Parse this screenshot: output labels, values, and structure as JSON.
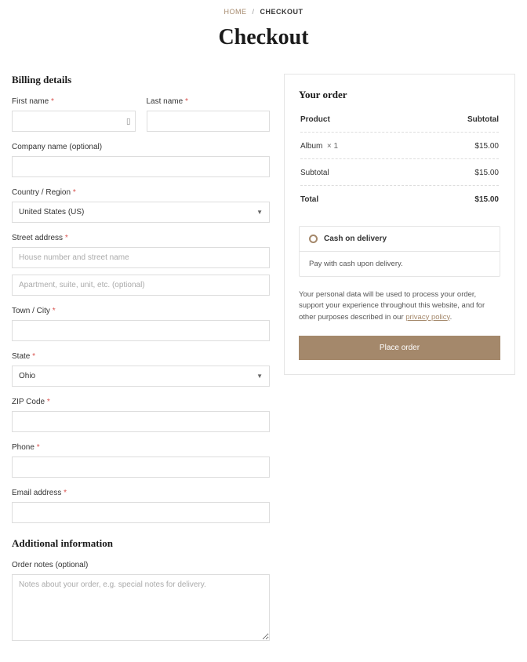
{
  "breadcrumb": {
    "home": "HOME",
    "current": "CHECKOUT"
  },
  "page_title": "Checkout",
  "billing": {
    "heading": "Billing details",
    "first_name": {
      "label": "First name",
      "value": ""
    },
    "last_name": {
      "label": "Last name",
      "value": ""
    },
    "company": {
      "label": "Company name (optional)",
      "value": ""
    },
    "country": {
      "label": "Country / Region",
      "value": "United States (US)"
    },
    "street": {
      "label": "Street address",
      "placeholder1": "House number and street name",
      "placeholder2": "Apartment, suite, unit, etc. (optional)"
    },
    "city": {
      "label": "Town / City",
      "value": ""
    },
    "state": {
      "label": "State",
      "value": "Ohio"
    },
    "zip": {
      "label": "ZIP Code",
      "value": ""
    },
    "phone": {
      "label": "Phone",
      "value": ""
    },
    "email": {
      "label": "Email address",
      "value": ""
    }
  },
  "additional": {
    "heading": "Additional information",
    "notes": {
      "label": "Order notes (optional)",
      "placeholder": "Notes about your order, e.g. special notes for delivery."
    }
  },
  "order": {
    "heading": "Your order",
    "col_product": "Product",
    "col_subtotal": "Subtotal",
    "items": [
      {
        "name": "Album",
        "qty": "× 1",
        "price": "$15.00"
      }
    ],
    "subtotal_label": "Subtotal",
    "subtotal_value": "$15.00",
    "total_label": "Total",
    "total_value": "$15.00"
  },
  "payment": {
    "method": "Cash on delivery",
    "desc": "Pay with cash upon delivery."
  },
  "privacy": {
    "text_before": "Your personal data will be used to process your order, support your experience throughout this website, and for other purposes described in our ",
    "link": "privacy policy",
    "text_after": "."
  },
  "place_order": "Place order",
  "required_mark": "*"
}
